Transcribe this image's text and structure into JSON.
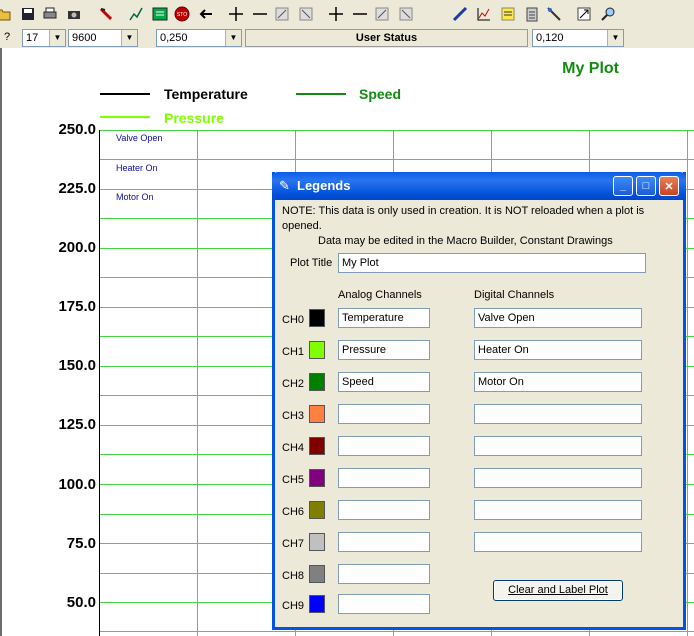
{
  "toolbar": {
    "icons": [
      "open-folder-icon",
      "save-icon",
      "print-icon",
      "camera-icon",
      "marker-icon",
      "pen-icon",
      "grid-icon",
      "stop-icon",
      "back-arrow-icon",
      "cross-add-icon",
      "minus-icon",
      "slash-icon",
      "slash2-icon",
      "cross-add2-icon",
      "minus2-icon",
      "line-icon",
      "line2-icon",
      "pencil-icon",
      "chart-icon",
      "note-icon",
      "clipboard-icon",
      "probe-icon",
      "resize-icon",
      "zoom-icon"
    ],
    "combo1": "17",
    "combo2": "9600",
    "combo3": "0,250",
    "status_label": "User Status",
    "combo4": "0,120",
    "help_glyph": "?"
  },
  "plot": {
    "title": "My Plot",
    "legend": [
      {
        "name": "Temperature",
        "color": "#000000"
      },
      {
        "name": "Speed",
        "color": "#138a13"
      },
      {
        "name": "Pressure",
        "color": "#7fff00"
      }
    ],
    "y_ticks": [
      "250.0",
      "225.0",
      "200.0",
      "175.0",
      "150.0",
      "125.0",
      "100.0",
      "75.0",
      "50.0"
    ],
    "digital_labels": [
      "Valve Open",
      "Heater On",
      "Motor On"
    ]
  },
  "dialog": {
    "title": "Legends",
    "note_line1": "NOTE: This data is only used in creation. It is NOT reloaded when a plot is opened.",
    "note_line2": "Data may be edited in the Macro Builder, Constant Drawings",
    "plot_title_label": "Plot Title",
    "plot_title_value": "My Plot",
    "analog_header": "Analog Channels",
    "digital_header": "Digital Channels",
    "channels": [
      {
        "label": "CH0",
        "color": "#000000",
        "analog": "Temperature",
        "digital": "Valve Open"
      },
      {
        "label": "CH1",
        "color": "#80ff00",
        "analog": "Pressure",
        "digital": "Heater On"
      },
      {
        "label": "CH2",
        "color": "#008000",
        "analog": "Speed",
        "digital": "Motor On"
      },
      {
        "label": "CH3",
        "color": "#ff8040",
        "analog": "",
        "digital": ""
      },
      {
        "label": "CH4",
        "color": "#800000",
        "analog": "",
        "digital": ""
      },
      {
        "label": "CH5",
        "color": "#800080",
        "analog": "",
        "digital": ""
      },
      {
        "label": "CH6",
        "color": "#808000",
        "analog": "",
        "digital": ""
      },
      {
        "label": "CH7",
        "color": "#c0c0c0",
        "analog": "",
        "digital": ""
      },
      {
        "label": "CH8",
        "color": "#808080",
        "analog": "",
        "digital": ""
      },
      {
        "label": "CH9",
        "color": "#0000ff",
        "analog": ""
      }
    ],
    "clear_button": "Clear and Label Plot"
  }
}
